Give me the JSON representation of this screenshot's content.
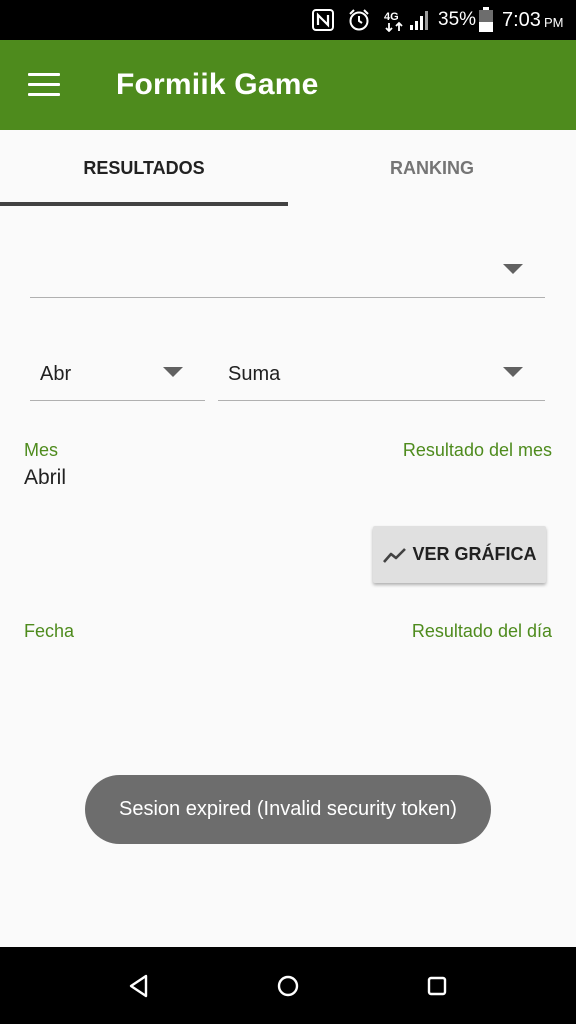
{
  "status_bar": {
    "battery": "35%",
    "time": "7:03",
    "ampm": "PM",
    "icons": [
      "nfc-icon",
      "alarm-icon",
      "data-4g-icon",
      "signal-icon",
      "battery-icon"
    ]
  },
  "app_bar": {
    "title": "Formiik Game",
    "menu_icon": "hamburger-menu-icon",
    "color": "#4e8b1d"
  },
  "tabs": [
    {
      "label": "RESULTADOS",
      "selected": true
    },
    {
      "label": "RANKING",
      "selected": false
    }
  ],
  "filters": {
    "top_spinner": {
      "value": ""
    },
    "month_spinner": {
      "value": "Abr"
    },
    "type_spinner": {
      "value": "Suma"
    }
  },
  "summary": {
    "month_label": "Mes",
    "month_value": "Abril",
    "result_label": "Resultado del mes"
  },
  "chart_button": {
    "label": "VER GRÁFICA",
    "icon": "trending-up-icon"
  },
  "table_headers": {
    "date": "Fecha",
    "result": "Resultado del día"
  },
  "toast": {
    "message": "Sesion expired (Invalid security token)"
  },
  "nav_bar": {
    "icons": [
      "back-icon",
      "home-icon",
      "recents-icon"
    ]
  }
}
